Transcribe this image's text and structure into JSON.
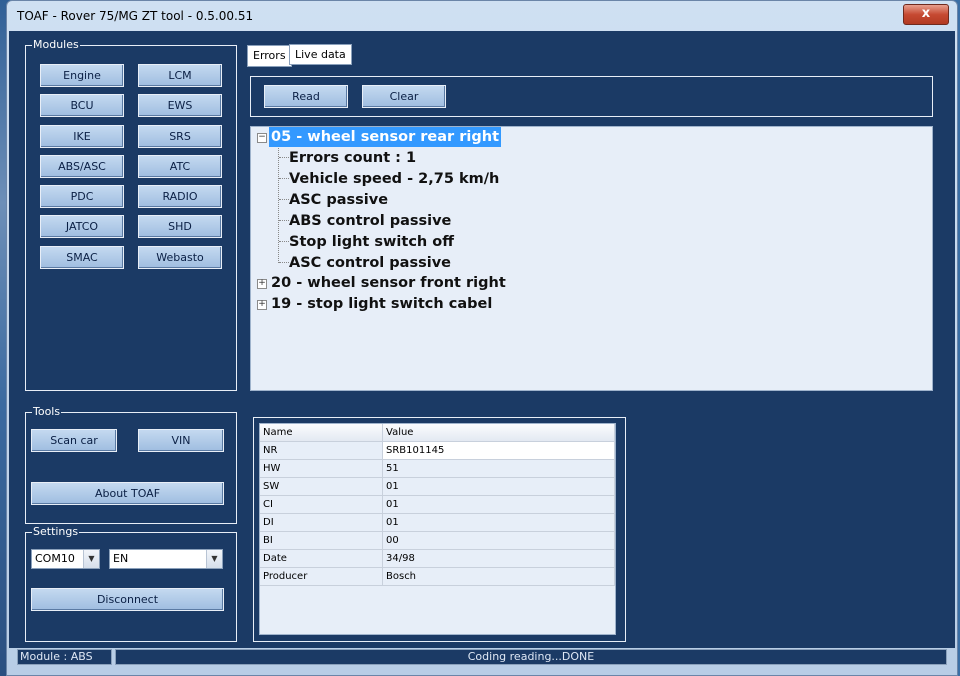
{
  "window": {
    "title": "TOAF - Rover 75/MG ZT tool - 0.5.00.51",
    "close": "x"
  },
  "modules": {
    "label": "Modules",
    "buttons": [
      "Engine",
      "LCM",
      "BCU",
      "EWS",
      "IKE",
      "SRS",
      "ABS/ASC",
      "ATC",
      "PDC",
      "RADIO",
      "JATCO",
      "SHD",
      "SMAC",
      "Webasto"
    ]
  },
  "tools": {
    "label": "Tools",
    "scan_car": "Scan car",
    "vin": "VIN",
    "about": "About TOAF"
  },
  "settings": {
    "label": "Settings",
    "port_value": "COM10",
    "lang_value": "EN",
    "disconnect": "Disconnect"
  },
  "tabs": {
    "errors": "Errors",
    "live": "Live data"
  },
  "actions": {
    "read": "Read",
    "clear": "Clear"
  },
  "tree": {
    "root1": "05 - wheel sensor rear right",
    "children": [
      "Errors count : 1",
      "Vehicle speed - 2,75 km/h",
      "ASC passive",
      "ABS control passive",
      "Stop light switch off",
      "ASC control passive"
    ],
    "root2": "20 - wheel sensor front right",
    "root3": "19 - stop light switch cabel",
    "collapse_glyph": "−",
    "expand_glyph": "+"
  },
  "info_table": {
    "headers": [
      "Name",
      "Value"
    ],
    "rows": [
      [
        "NR",
        "SRB101145"
      ],
      [
        "HW",
        "51"
      ],
      [
        "SW",
        "01"
      ],
      [
        "CI",
        "01"
      ],
      [
        "DI",
        "01"
      ],
      [
        "BI",
        "00"
      ],
      [
        "Date",
        "34/98"
      ],
      [
        "Producer",
        "Bosch"
      ]
    ]
  },
  "status": {
    "module": "Module : ABS",
    "message": "Coding reading...DONE"
  },
  "icons": {
    "dropdown": "▼"
  }
}
